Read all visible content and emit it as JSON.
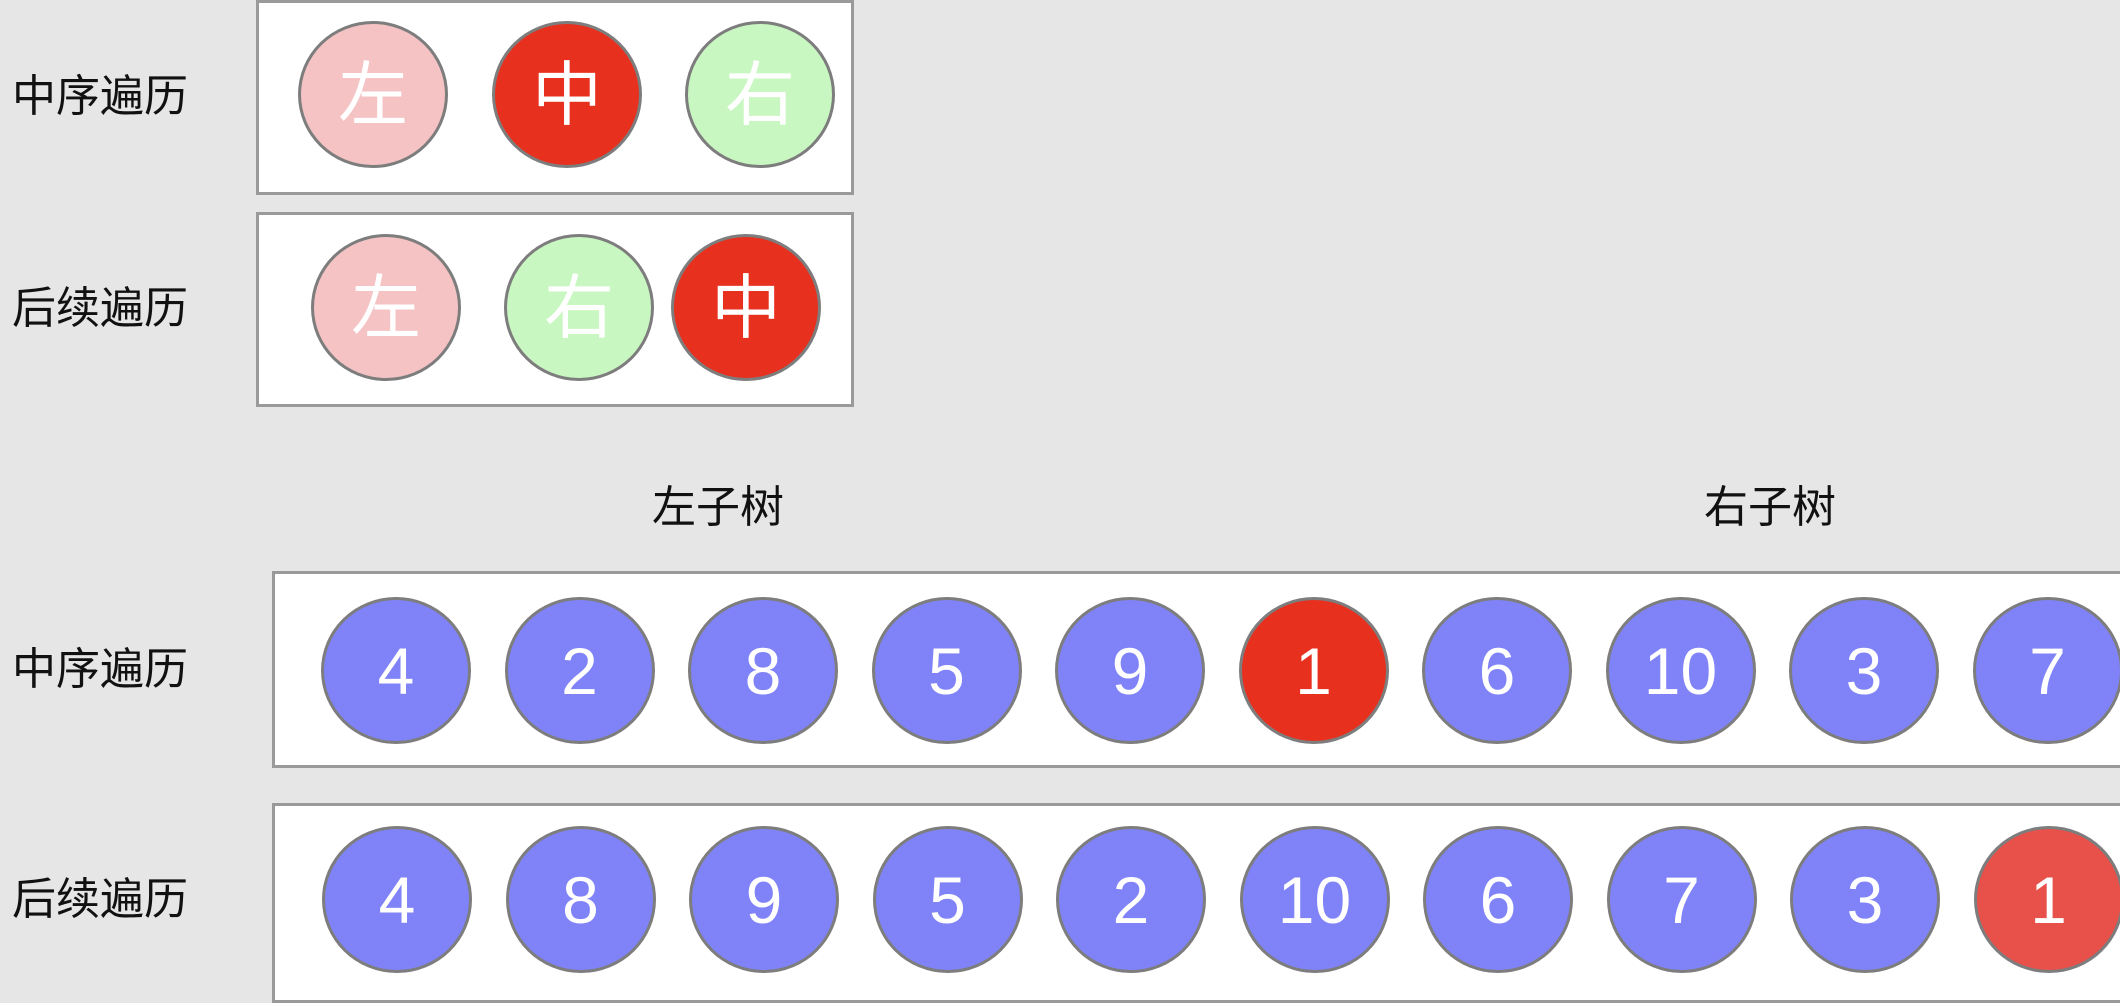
{
  "legend": {
    "inorder": {
      "label": "中序遍历",
      "nodes": [
        {
          "text": "左",
          "color": "#f5c3c4"
        },
        {
          "text": "中",
          "color": "#e8301f"
        },
        {
          "text": "右",
          "color": "#c9f7c1"
        }
      ]
    },
    "postorder": {
      "label": "后续遍历",
      "nodes": [
        {
          "text": "左",
          "color": "#f5c3c4"
        },
        {
          "text": "右",
          "color": "#c9f7c1"
        },
        {
          "text": "中",
          "color": "#e8301f"
        }
      ]
    }
  },
  "subtree_labels": {
    "left": "左子树",
    "right": "右子树"
  },
  "sequences": {
    "inorder": {
      "label": "中序遍历",
      "values": [
        "4",
        "2",
        "8",
        "5",
        "9",
        "1",
        "6",
        "10",
        "3",
        "7"
      ],
      "highlight_value": "1"
    },
    "postorder": {
      "label": "后续遍历",
      "values": [
        "4",
        "8",
        "9",
        "5",
        "2",
        "10",
        "6",
        "7",
        "3",
        "1"
      ],
      "highlight_value": "1"
    }
  },
  "colors": {
    "node_default": "#8083f7",
    "root_highlight_inorder": "#e8301f",
    "root_highlight_postorder": "#e8504a",
    "background": "#e6e6e6"
  }
}
